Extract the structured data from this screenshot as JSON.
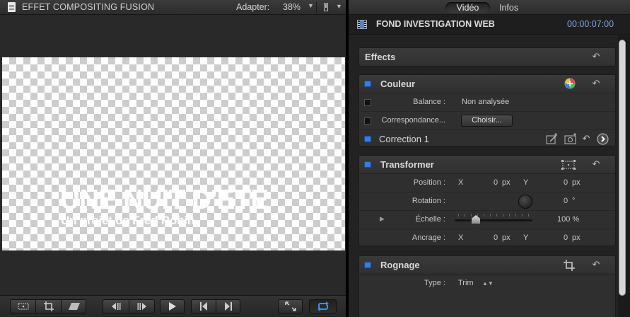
{
  "viewer": {
    "title": "EFFET COMPOSITING FUSION",
    "zoom_label": "Adapter:",
    "zoom_value": "38%",
    "overlay_title": "UNE NUIT D'ETE",
    "overlay_subtitle": "Un projet de Fred Robin"
  },
  "inspector": {
    "tabs": {
      "video": "Vidéo",
      "infos": "Infos"
    },
    "clip_name": "FOND INVESTIGATION WEB",
    "clip_duration": "00:00:07:00",
    "effects_label": "Effects",
    "couleur": {
      "title": "Couleur",
      "balance_label": "Balance :",
      "balance_value": "Non analysée",
      "match_label": "Correspondance...",
      "match_button": "Choisir...",
      "correction_label": "Correction 1"
    },
    "transformer": {
      "title": "Transformer",
      "position_label": "Position :",
      "position_x_label": "X",
      "position_x_value": "0",
      "position_x_unit": "px",
      "position_y_label": "Y",
      "position_y_value": "0",
      "position_y_unit": "px",
      "rotation_label": "Rotation :",
      "rotation_value": "0",
      "rotation_unit": "°",
      "scale_label": "Échelle :",
      "scale_value": "100 %",
      "anchor_label": "Ancrage :",
      "anchor_x_label": "X",
      "anchor_x_value": "0",
      "anchor_x_unit": "px",
      "anchor_y_label": "Y",
      "anchor_y_value": "0",
      "anchor_y_unit": "px"
    },
    "rognage": {
      "title": "Rognage",
      "type_label": "Type :",
      "type_value": "Trim"
    }
  },
  "colors": {
    "accent_blue": "#3a7be4",
    "timecode_blue": "#7fa6e0",
    "panel_bg": "#2f2f2f"
  }
}
